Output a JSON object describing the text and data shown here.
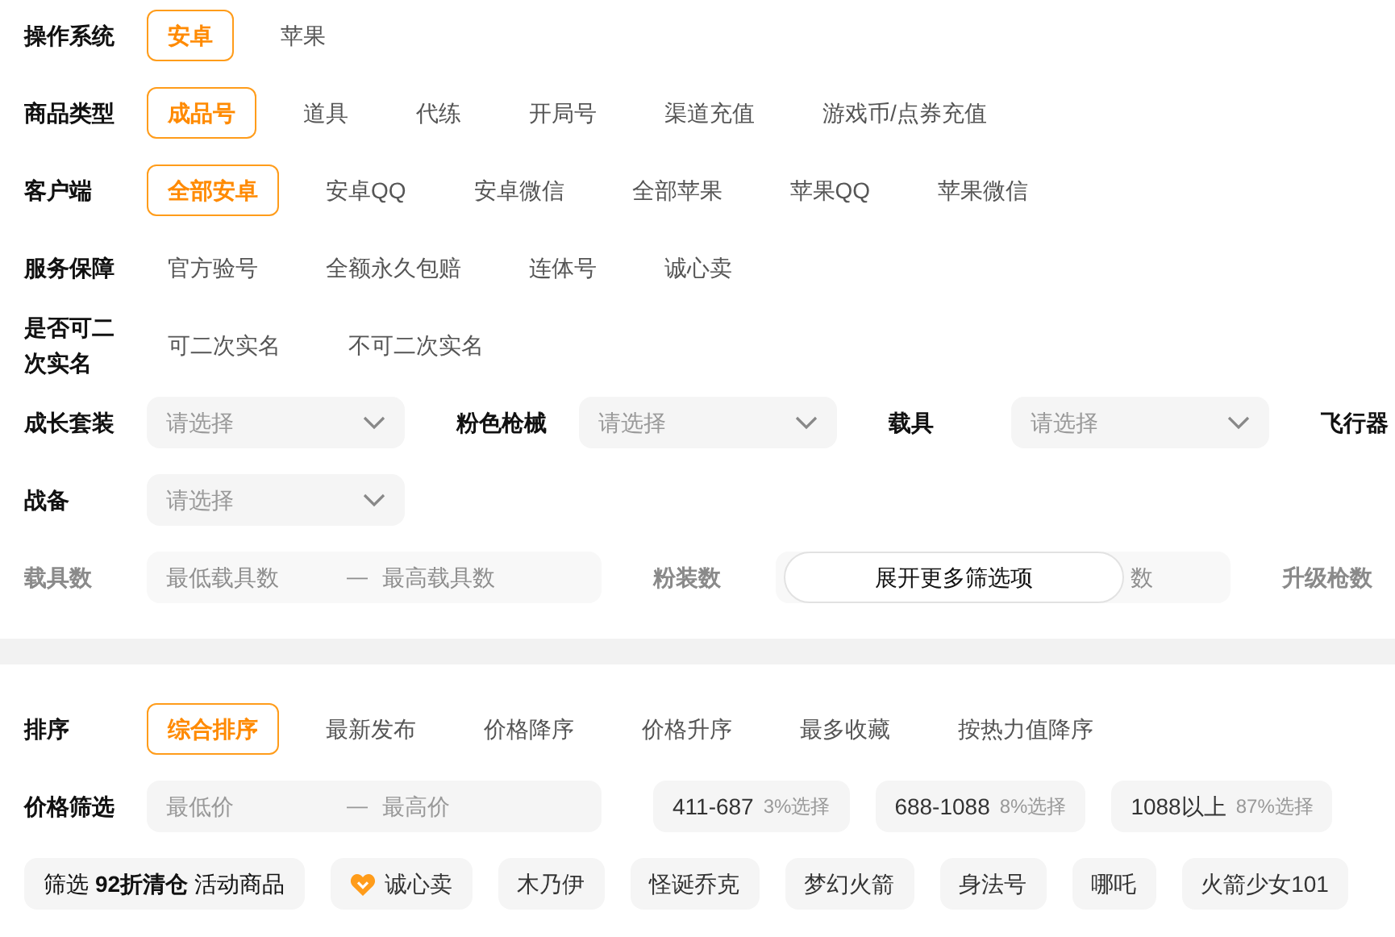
{
  "filters": [
    {
      "kind": "options",
      "label": "操作系统",
      "options": [
        {
          "label": "安卓",
          "selected": true
        },
        {
          "label": "苹果",
          "selected": false
        }
      ]
    },
    {
      "kind": "options",
      "label": "商品类型",
      "options": [
        {
          "label": "成品号",
          "selected": true
        },
        {
          "label": "道具",
          "selected": false
        },
        {
          "label": "代练",
          "selected": false
        },
        {
          "label": "开局号",
          "selected": false
        },
        {
          "label": "渠道充值",
          "selected": false
        },
        {
          "label": "游戏币/点券充值",
          "selected": false
        }
      ]
    },
    {
      "kind": "options",
      "label": "客户端",
      "options": [
        {
          "label": "全部安卓",
          "selected": true
        },
        {
          "label": "安卓QQ",
          "selected": false
        },
        {
          "label": "安卓微信",
          "selected": false
        },
        {
          "label": "全部苹果",
          "selected": false
        },
        {
          "label": "苹果QQ",
          "selected": false
        },
        {
          "label": "苹果微信",
          "selected": false
        }
      ]
    },
    {
      "kind": "options",
      "label": "服务保障",
      "options": [
        {
          "label": "官方验号",
          "selected": false
        },
        {
          "label": "全额永久包赔",
          "selected": false
        },
        {
          "label": "连体号",
          "selected": false
        },
        {
          "label": "诚心卖",
          "selected": false
        }
      ]
    },
    {
      "kind": "options",
      "label": "是否可二次实名",
      "options": [
        {
          "label": "可二次实名",
          "selected": false
        },
        {
          "label": "不可二次实名",
          "selected": false
        }
      ]
    },
    {
      "kind": "selects",
      "fields": [
        {
          "label": "成长套装",
          "placeholder": "请选择"
        },
        {
          "label": "粉色枪械",
          "placeholder": "请选择"
        },
        {
          "label": "载具",
          "placeholder": "请选择"
        },
        {
          "label": "飞行器"
        }
      ]
    },
    {
      "kind": "selects",
      "fields": [
        {
          "label": "战备",
          "placeholder": "请选择"
        }
      ]
    }
  ],
  "collapsed_preview": {
    "fields": [
      {
        "label": "载具数",
        "min_placeholder": "最低载具数",
        "separator": "—",
        "max_placeholder": "最高载具数"
      },
      {
        "label": "粉装数",
        "max_placeholder": "数"
      },
      {
        "label": "升级枪数"
      }
    ],
    "expand_button": "展开更多筛选项"
  },
  "sort": {
    "label": "排序",
    "options": [
      {
        "label": "综合排序",
        "selected": true
      },
      {
        "label": "最新发布",
        "selected": false
      },
      {
        "label": "价格降序",
        "selected": false
      },
      {
        "label": "价格升序",
        "selected": false
      },
      {
        "label": "最多收藏",
        "selected": false
      },
      {
        "label": "按热力值降序",
        "selected": false
      }
    ]
  },
  "price_filter": {
    "label": "价格筛选",
    "min_placeholder": "最低价",
    "separator": "—",
    "max_placeholder": "最高价",
    "presets": [
      {
        "range": "411-687",
        "share": "3%选择"
      },
      {
        "range": "688-1088",
        "share": "8%选择"
      },
      {
        "range": "1088以上",
        "share": "87%选择"
      }
    ]
  },
  "quick_tags": [
    {
      "kind": "promo",
      "text": "筛选 **92折清仓** 活动商品"
    },
    {
      "kind": "heart",
      "text": "诚心卖"
    },
    {
      "kind": "plain",
      "text": "木乃伊"
    },
    {
      "kind": "plain",
      "text": "怪诞乔克"
    },
    {
      "kind": "plain",
      "text": "梦幻火箭"
    },
    {
      "kind": "plain",
      "text": "身法号"
    },
    {
      "kind": "plain",
      "text": "哪吒"
    },
    {
      "kind": "plain",
      "text": "火箭少女101"
    }
  ]
}
